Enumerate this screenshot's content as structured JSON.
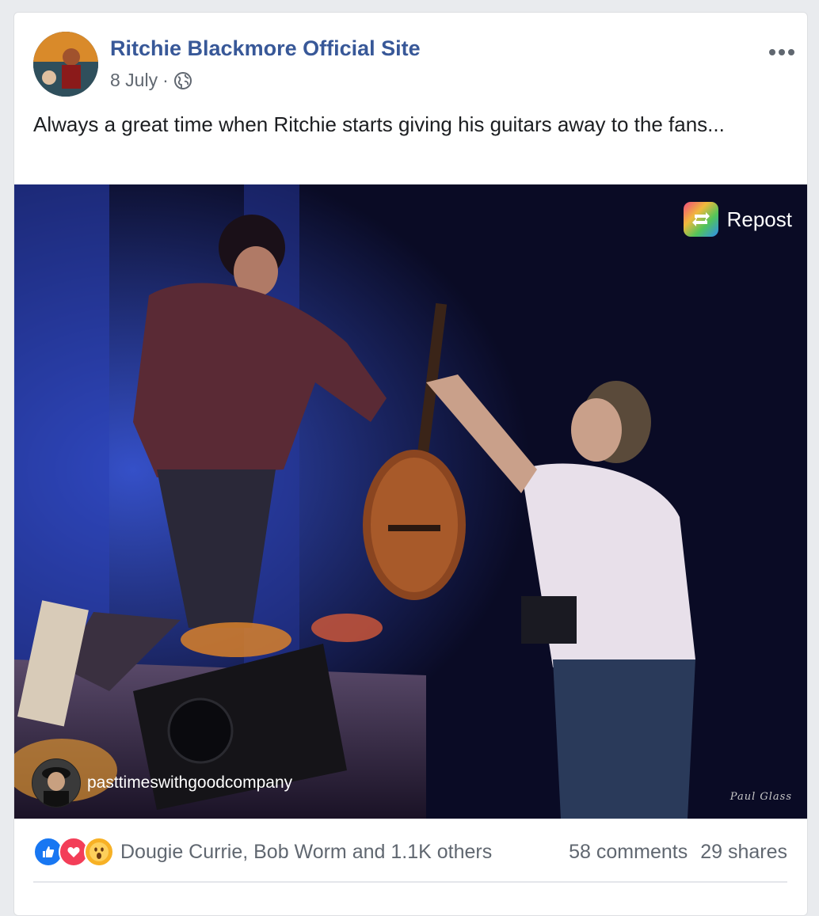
{
  "post": {
    "page_name": "Ritchie Blackmore Official Site",
    "date": "8 July",
    "separator": "·",
    "privacy_icon": "globe-icon",
    "more_icon": "more-options-icon",
    "text": "Always a great time when Ritchie starts giving his guitars away to the fans..."
  },
  "photo": {
    "repost_label": "Repost",
    "repost_icon": "repost-icon",
    "credit_handle": "pasttimeswithgoodcompany",
    "watermark": "Paul Glass"
  },
  "footer": {
    "reaction_icons": [
      "like-icon",
      "love-icon",
      "wow-icon"
    ],
    "reactors": "Dougie Currie, Bob Worm and 1.1K others",
    "comments": "58 comments",
    "shares": "29 shares"
  },
  "colors": {
    "page_name": "#385898",
    "like": "#1877f2",
    "love": "#f33e58",
    "wow": "#f7b125"
  }
}
